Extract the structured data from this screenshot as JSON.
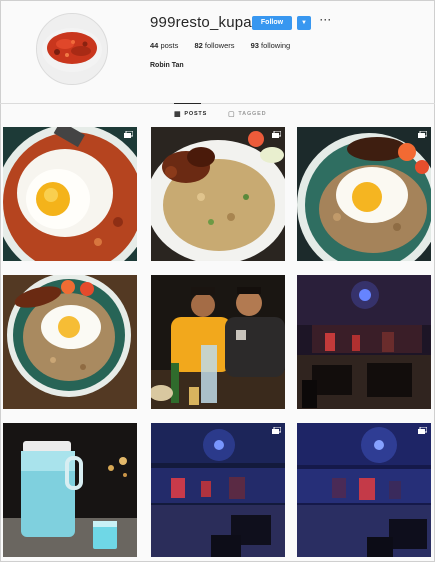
{
  "profile": {
    "username": "999resto_kupang",
    "follow_label": "Follow",
    "more_glyph": "···",
    "dropdown_glyph": "▼",
    "posts_count": "44",
    "posts_label": "posts",
    "followers_count": "82",
    "followers_label": "followers",
    "following_count": "93",
    "following_label": "following",
    "full_name": "Robin Tan"
  },
  "tabs": [
    {
      "label": "POSTS",
      "icon": "grid-icon",
      "active": true
    },
    {
      "label": "TAGGED",
      "icon": "tag-icon",
      "active": false
    }
  ],
  "posts": [
    {
      "kind": "fried-rice-egg-closeup",
      "carousel": true
    },
    {
      "kind": "fried-rice-sausage-plate",
      "carousel": true
    },
    {
      "kind": "fried-rice-egg-sausage",
      "carousel": true
    },
    {
      "kind": "fried-rice-egg-wooden-table",
      "carousel": false
    },
    {
      "kind": "two-men-selfie",
      "carousel": false
    },
    {
      "kind": "dark-restaurant-stage",
      "carousel": false
    },
    {
      "kind": "blue-drink-jug",
      "carousel": false
    },
    {
      "kind": "stage-blue-lights",
      "carousel": true
    },
    {
      "kind": "stage-blue-lights-2",
      "carousel": true
    }
  ],
  "colors": {
    "accent": "#3897f0",
    "text": "#262626",
    "muted": "#999999",
    "background": "#fafafa"
  }
}
